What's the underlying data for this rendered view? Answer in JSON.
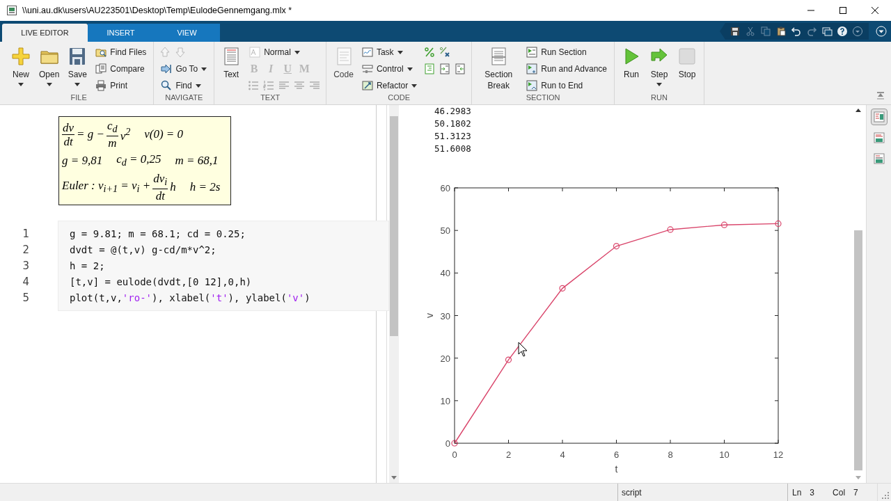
{
  "window": {
    "title": "\\\\uni.au.dk\\users\\AU223501\\Desktop\\Temp\\EulodeGennemgang.mlx *"
  },
  "tabs": [
    {
      "label": "LIVE EDITOR",
      "selected": true
    },
    {
      "label": "INSERT",
      "selected": false
    },
    {
      "label": "VIEW",
      "selected": false
    }
  ],
  "ribbon": {
    "groups": [
      {
        "label": "FILE",
        "items": [
          {
            "kind": "large",
            "label": "New",
            "dropdown": true,
            "disabled": false
          },
          {
            "kind": "large",
            "label": "Open",
            "dropdown": true,
            "disabled": false
          },
          {
            "kind": "large",
            "label": "Save",
            "dropdown": true,
            "disabled": false
          },
          {
            "kind": "stack",
            "rows": [
              {
                "kind": "button",
                "label": "Find Files",
                "dropdown": false,
                "disabled": false
              },
              {
                "kind": "button",
                "label": "Compare",
                "dropdown": false,
                "disabled": false
              },
              {
                "kind": "button",
                "label": "Print",
                "dropdown": false,
                "disabled": false
              }
            ]
          }
        ]
      },
      {
        "label": "NAVIGATE",
        "items": [
          {
            "kind": "stack",
            "rows": [
              {
                "kind": "icons",
                "buttons": [
                  {
                    "disabled": true
                  },
                  {
                    "disabled": true
                  }
                ]
              },
              {
                "kind": "button",
                "label": "Go To",
                "dropdown": true,
                "disabled": false
              },
              {
                "kind": "button",
                "label": "Find",
                "dropdown": true,
                "disabled": false
              }
            ]
          }
        ]
      },
      {
        "label": "TEXT",
        "items": [
          {
            "kind": "large",
            "label": "Text",
            "dropdown": false,
            "disabled": false
          },
          {
            "kind": "stack",
            "rows": [
              {
                "kind": "button",
                "label": "Normal",
                "dropdown": true,
                "disabled": false
              },
              {
                "kind": "letters",
                "buttons": [
                  {
                    "label": "B",
                    "disabled": true
                  },
                  {
                    "label": "I",
                    "disabled": true
                  },
                  {
                    "label": "U",
                    "disabled": true
                  },
                  {
                    "label": "M",
                    "disabled": true
                  }
                ]
              },
              {
                "kind": "icons",
                "buttons": [
                  {
                    "disabled": true
                  },
                  {
                    "disabled": true
                  },
                  {
                    "disabled": true
                  },
                  {
                    "disabled": true
                  },
                  {
                    "disabled": true
                  }
                ]
              }
            ]
          }
        ]
      },
      {
        "label": "CODE",
        "items": [
          {
            "kind": "large",
            "label": "Code",
            "dropdown": false,
            "disabled": true
          },
          {
            "kind": "stack",
            "rows": [
              {
                "kind": "button",
                "label": "Task",
                "dropdown": true,
                "disabled": false
              },
              {
                "kind": "button",
                "label": "Control",
                "dropdown": true,
                "disabled": false
              },
              {
                "kind": "button",
                "label": "Refactor",
                "dropdown": true,
                "disabled": false
              }
            ]
          },
          {
            "kind": "stack",
            "rows": [
              {
                "kind": "icons",
                "buttons": [
                  {
                    "disabled": false
                  },
                  {
                    "disabled": false
                  }
                ]
              },
              {
                "kind": "icons",
                "buttons": [
                  {
                    "disabled": false
                  },
                  {
                    "disabled": false
                  },
                  {
                    "disabled": false
                  }
                ]
              }
            ]
          }
        ]
      },
      {
        "label": "SECTION",
        "items": [
          {
            "kind": "large",
            "label": "Section Break",
            "dropdown": false,
            "disabled": false
          },
          {
            "kind": "stack",
            "rows": [
              {
                "kind": "button",
                "label": "Run Section",
                "dropdown": false,
                "disabled": false
              },
              {
                "kind": "button",
                "label": "Run and Advance",
                "dropdown": false,
                "disabled": false
              },
              {
                "kind": "button",
                "label": "Run to End",
                "dropdown": false,
                "disabled": false
              }
            ]
          }
        ]
      },
      {
        "label": "RUN",
        "items": [
          {
            "kind": "large",
            "label": "Run",
            "dropdown": false,
            "disabled": false
          },
          {
            "kind": "large",
            "label": "Step",
            "dropdown": true,
            "disabled": false
          },
          {
            "kind": "large",
            "label": "Stop",
            "dropdown": false,
            "disabled": false
          }
        ]
      }
    ]
  },
  "editor": {
    "equation": {
      "lines": [
        [
          {
            "kind": "frac",
            "num": "dv",
            "den": "dt"
          },
          {
            "kind": "text",
            "text": "= g −"
          },
          {
            "kind": "frac",
            "num": "c$_{d}$",
            "den": "m"
          },
          {
            "kind": "text",
            "text": "v$^{2}$"
          },
          {
            "kind": "gap"
          },
          {
            "kind": "text",
            "text": "v(0) = 0"
          }
        ],
        [
          {
            "kind": "text",
            "text": "g = 9,81"
          },
          {
            "kind": "gap"
          },
          {
            "kind": "text",
            "text": "c$_{d}$ = 0,25"
          },
          {
            "kind": "gap"
          },
          {
            "kind": "text",
            "text": "m = 68,1"
          }
        ],
        [
          {
            "kind": "text",
            "text": "Euler : v$_{i+1}$ = v$_{i}$ +"
          },
          {
            "kind": "frac",
            "num": "dv$_{i}$",
            "den": "dt"
          },
          {
            "kind": "text",
            "text": "h"
          },
          {
            "kind": "gap"
          },
          {
            "kind": "text",
            "text": "h = 2s"
          }
        ]
      ]
    },
    "code": {
      "lines": [
        {
          "number": "1",
          "tokens": [
            {
              "kind": "plain",
              "text": "g = 9.81; m = 68.1; cd = 0.25;"
            }
          ]
        },
        {
          "number": "2",
          "tokens": [
            {
              "kind": "plain",
              "text": "dvdt = @(t,v) g-cd/m*v^2;"
            }
          ]
        },
        {
          "number": "3",
          "tokens": [
            {
              "kind": "plain",
              "text": "h = 2;"
            }
          ]
        },
        {
          "number": "4",
          "tokens": [
            {
              "kind": "plain",
              "text": "[t,v] = eulode(dvdt,[0 12],0,h)"
            }
          ]
        },
        {
          "number": "5",
          "tokens": [
            {
              "kind": "plain",
              "text": "plot(t,v,"
            },
            {
              "kind": "string",
              "text": "'ro-'"
            },
            {
              "kind": "plain",
              "text": "), xlabel("
            },
            {
              "kind": "string",
              "text": "'t'"
            },
            {
              "kind": "plain",
              "text": "), ylabel("
            },
            {
              "kind": "string",
              "text": "'v'"
            },
            {
              "kind": "plain",
              "text": ")"
            }
          ]
        }
      ]
    }
  },
  "output": {
    "values": [
      "46.2983",
      "50.1802",
      "51.3123",
      "51.6008"
    ],
    "chart_data": {
      "type": "line",
      "xlabel": "t",
      "ylabel": "v",
      "x": [
        0,
        2,
        4,
        6,
        8,
        10,
        12
      ],
      "series": [
        {
          "color": "#d9446a",
          "marker": "o",
          "values": [
            0,
            19.6,
            36.4,
            46.3,
            50.2,
            51.3,
            51.6
          ]
        }
      ],
      "xlim": [
        0,
        12
      ],
      "ylim": [
        0,
        60
      ],
      "xticks": [
        0,
        2,
        4,
        6,
        8,
        10,
        12
      ],
      "yticks": [
        0,
        10,
        20,
        30,
        40,
        50,
        60
      ]
    }
  },
  "output_views": [
    {
      "selected": true
    },
    {
      "selected": false
    },
    {
      "selected": false
    }
  ],
  "status_bar": {
    "mode": "script",
    "line_label": "Ln",
    "line": "3",
    "col_label": "Col",
    "col": "7"
  }
}
